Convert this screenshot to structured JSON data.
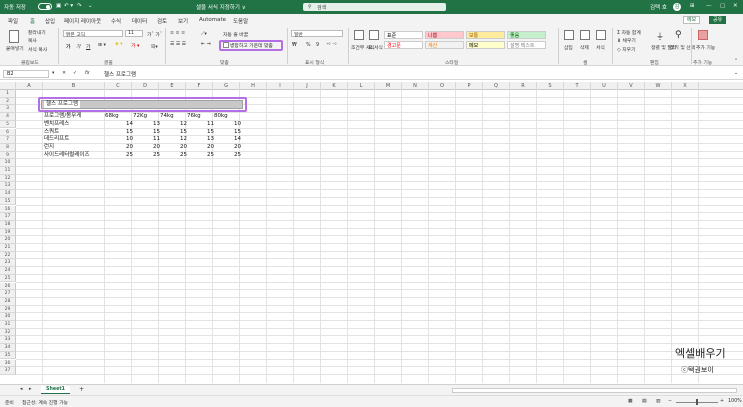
{
  "titlebar": {
    "autosave": "자동 저장",
    "autosave_state": "켬",
    "doc_title": "셀을 서식 지정하기 ∨",
    "search_placeholder": "검색",
    "user": "김택 호",
    "ribbon_display": "⊞",
    "minimize": "—",
    "maximize": "▢",
    "close": "✕"
  },
  "menu": {
    "tabs": [
      "파일",
      "홈",
      "삽입",
      "페이지 레이아웃",
      "수식",
      "데이터",
      "검토",
      "보기",
      "Automate",
      "도움말"
    ],
    "active_index": 1,
    "memo": "메모",
    "share": "공유"
  },
  "ribbon": {
    "clipboard": {
      "paste": "붙여넣기",
      "cut": "잘라내기",
      "copy": "복사",
      "format_painter": "서식 복사",
      "label": "클립보드"
    },
    "font": {
      "name": "맑은 고딕",
      "size": "11",
      "label": "글꼴",
      "bold": "가",
      "italic": "가",
      "underline": "가"
    },
    "alignment": {
      "wrap": "자동 줄 바꿈",
      "merge": "병합하고 가운데 맞춤",
      "label": "맞춤"
    },
    "number": {
      "format": "일반",
      "label": "표시 형식",
      "currency": "₩",
      "percent": "%",
      "comma": "9"
    },
    "styles": {
      "conditional": "조건부 서식",
      "as_table": "표 서식",
      "cells": [
        {
          "text": "표준",
          "bg": "#ffffff",
          "fg": "#000000"
        },
        {
          "text": "나쁨",
          "bg": "#ffc7ce",
          "fg": "#9c0006"
        },
        {
          "text": "보통",
          "bg": "#ffeb9c",
          "fg": "#9c5700"
        },
        {
          "text": "좋음",
          "bg": "#c6efce",
          "fg": "#006100"
        },
        {
          "text": "경고문",
          "bg": "#ffffff",
          "fg": "#ff0000"
        },
        {
          "text": "계산",
          "bg": "#f2f2f2",
          "fg": "#fa7d00"
        },
        {
          "text": "메모",
          "bg": "#ffffcc",
          "fg": "#000000"
        },
        {
          "text": "설명 텍스트",
          "bg": "#ffffff",
          "fg": "#7f7f7f"
        }
      ],
      "label": "스타일"
    },
    "cells_group": {
      "insert": "삽입",
      "delete": "삭제",
      "format": "서식",
      "label": "셀"
    },
    "editing": {
      "autosum": "자동 합계",
      "fill": "채우기",
      "clear": "지우기",
      "sort": "정렬 및 필터",
      "find": "찾기 및 선택",
      "label": "편집"
    },
    "addins": {
      "text": "추가 기능",
      "label": "추가 기능"
    }
  },
  "formula_bar": {
    "name_box": "B2",
    "fx": "fx",
    "content": "헬스 프로그램"
  },
  "sheet": {
    "columns": [
      "A",
      "B",
      "C",
      "D",
      "E",
      "F",
      "G",
      "H",
      "I",
      "J",
      "K",
      "L",
      "M",
      "N",
      "O",
      "P",
      "Q",
      "R",
      "S",
      "T",
      "U",
      "V",
      "W",
      "X"
    ],
    "title": "헬스 프로그램",
    "header_row": [
      "프로그램/몸무게",
      "68kg",
      "72Kg",
      "74kg",
      "76kg",
      "80kg"
    ],
    "rows": [
      {
        "name": "벤치프레스",
        "values": [
          "14",
          "13",
          "12",
          "11",
          "10"
        ]
      },
      {
        "name": "스쿼트",
        "values": [
          "15",
          "15",
          "15",
          "15",
          "15"
        ]
      },
      {
        "name": "데드리프트",
        "values": [
          "10",
          "11",
          "12",
          "13",
          "14"
        ]
      },
      {
        "name": "런지",
        "values": [
          "20",
          "20",
          "20",
          "20",
          "20"
        ]
      },
      {
        "name": "사이드레터럴레이즈",
        "values": [
          "25",
          "25",
          "25",
          "25",
          "25"
        ]
      }
    ],
    "row_count": 37,
    "tab_name": "Sheet1",
    "add_sheet": "+"
  },
  "status": {
    "ready": "준비",
    "accessibility": "접근성: 계속 진행 가능",
    "zoom": "100%"
  },
  "watermark": {
    "line1": "엑셀배우기",
    "line2": "ⓒ택권보이"
  },
  "highlight_color": "#b46ee6",
  "accent": "#217346"
}
